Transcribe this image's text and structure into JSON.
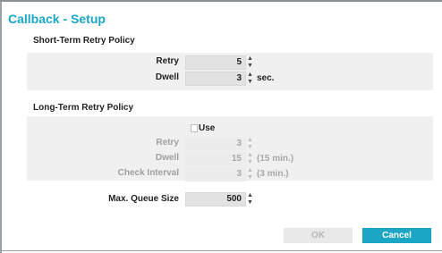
{
  "dialog": {
    "title": "Callback - Setup"
  },
  "short_term": {
    "title": "Short-Term Retry Policy",
    "retry_label": "Retry",
    "retry_value": "5",
    "dwell_label": "Dwell",
    "dwell_value": "3",
    "dwell_unit": "sec."
  },
  "long_term": {
    "title": "Long-Term Retry Policy",
    "use_label": "Use",
    "use_checked": false,
    "retry_label": "Retry",
    "retry_value": "3",
    "dwell_label": "Dwell",
    "dwell_value": "15",
    "dwell_unit": "(15 min.)",
    "interval_label": "Check Interval",
    "interval_value": "3",
    "interval_unit": "(3 min.)"
  },
  "queue": {
    "label": "Max. Queue Size",
    "value": "500"
  },
  "buttons": {
    "ok": "OK",
    "cancel": "Cancel"
  },
  "icons": {
    "spin_up": "▲",
    "spin_down": "▼"
  },
  "colors": {
    "accent": "#1aa6c4"
  }
}
